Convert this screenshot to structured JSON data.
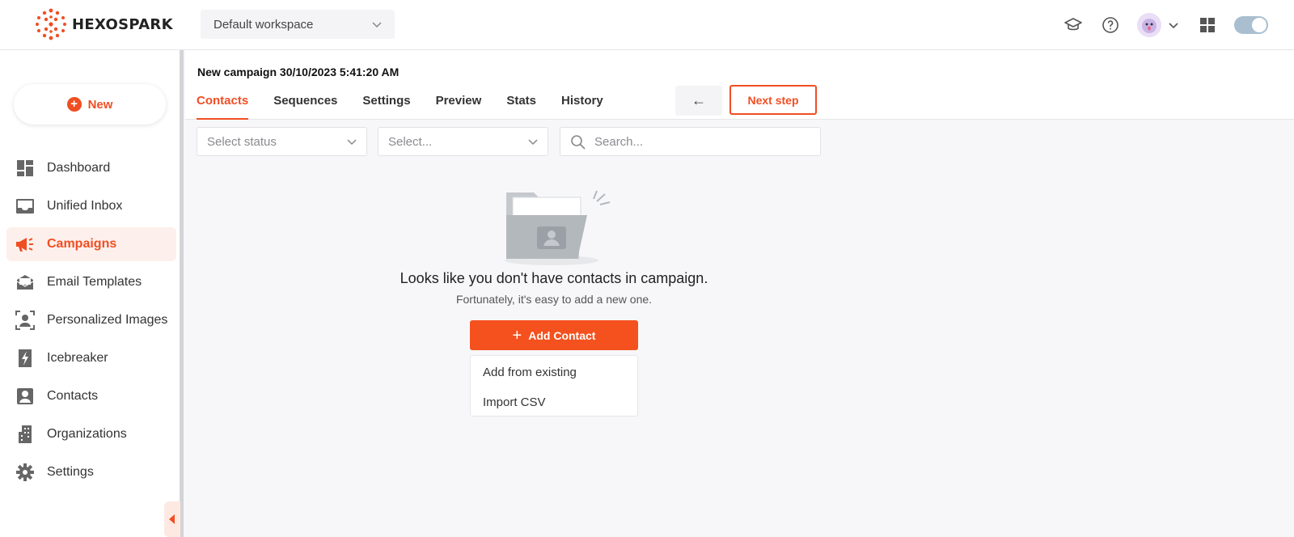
{
  "brand": {
    "name": "HEXOSPARK"
  },
  "workspace": {
    "selected": "Default workspace"
  },
  "header": {
    "icons": [
      "graduation-cap-icon",
      "help-icon",
      "avatar",
      "chevron-down-icon",
      "grid-icon",
      "theme-toggle"
    ]
  },
  "sidebar": {
    "new_label": "New",
    "items": [
      {
        "label": "Dashboard",
        "icon": "dashboard-icon"
      },
      {
        "label": "Unified Inbox",
        "icon": "inbox-icon"
      },
      {
        "label": "Campaigns",
        "icon": "megaphone-icon",
        "active": true
      },
      {
        "label": "Email Templates",
        "icon": "email-template-icon"
      },
      {
        "label": "Personalized Images",
        "icon": "personalized-image-icon"
      },
      {
        "label": "Icebreaker",
        "icon": "lightning-icon"
      },
      {
        "label": "Contacts",
        "icon": "contact-icon"
      },
      {
        "label": "Organizations",
        "icon": "building-icon"
      },
      {
        "label": "Settings",
        "icon": "gear-icon"
      }
    ]
  },
  "campaign": {
    "title": "New campaign 30/10/2023 5:41:20 AM",
    "tabs": [
      "Contacts",
      "Sequences",
      "Settings",
      "Preview",
      "Stats",
      "History"
    ],
    "active_tab": "Contacts",
    "back_label": "←",
    "next_label": "Next step"
  },
  "filters": {
    "status_placeholder": "Select status",
    "select_placeholder": "Select...",
    "search_placeholder": "Search..."
  },
  "empty_state": {
    "title": "Looks like you don't have contacts in campaign.",
    "subtitle": "Fortunately, it's easy to add a new one.",
    "add_label": "Add Contact",
    "menu": [
      "Add from existing",
      "Import CSV"
    ]
  },
  "colors": {
    "accent": "#f04e23",
    "button": "#f4511e",
    "active_bg": "#fdf0ec"
  }
}
